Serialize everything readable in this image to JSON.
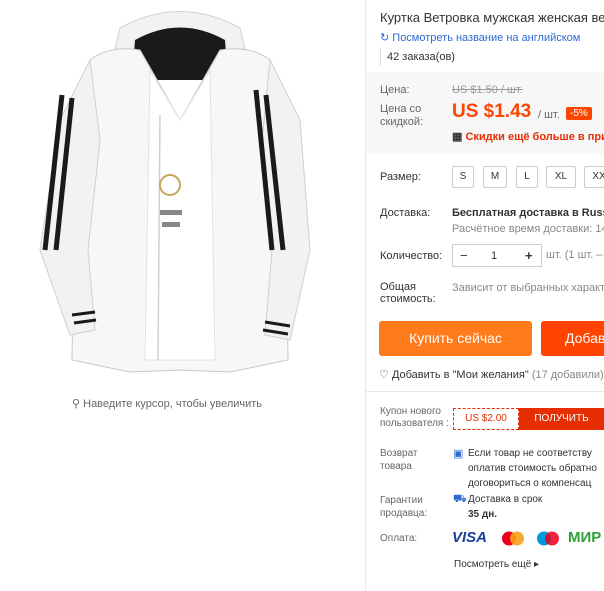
{
  "product": {
    "title": "Куртка Ветровка мужская женская ве",
    "translate_link": "Посмотреть название на английском",
    "orders": "42 заказа(ов)"
  },
  "gallery": {
    "zoom_hint": "Наведите курсор, чтобы увеличить"
  },
  "price": {
    "label": "Цена:",
    "old": "US $1.50 / шт.",
    "discount_label": "Цена со скидкой:",
    "new": "US $1.43",
    "per_unit": "/ шт.",
    "discount_badge": "-5%",
    "more_discounts": "Скидки ещё больше в прил"
  },
  "size": {
    "label": "Размер:",
    "options": [
      "S",
      "M",
      "L",
      "XL",
      "XX"
    ]
  },
  "delivery": {
    "label": "Доставка:",
    "value": "Бесплатная доставка в Russia",
    "time": "Расчётное время доставки: 14"
  },
  "quantity": {
    "label": "Количество:",
    "minus": "−",
    "value": "1",
    "plus": "+",
    "note": "шт. (1 шт. –"
  },
  "total": {
    "label": "Общая стоимость:",
    "value": "Зависит от выбранных характе"
  },
  "actions": {
    "buy_now": "Купить сейчас",
    "add_to_cart": "Добав",
    "wishlist": "Добавить в \"Мои желания\"",
    "wishlist_count": "(17 добавили)"
  },
  "coupon": {
    "label": "Купон нового пользователя :",
    "amount": "US $2.00",
    "button": "ПОЛУЧИТЬ"
  },
  "returns": {
    "label": "Возврат товара",
    "text_1": "Если товар не соответству",
    "text_2": "оплатив стоимость обратно",
    "text_3": "договориться о компенсац"
  },
  "guarantee": {
    "label": "Гарантии продавца:",
    "text": "Доставка в срок",
    "days": "35 дн."
  },
  "payment": {
    "label": "Оплата:",
    "visa": "VISA",
    "mir": "МИР",
    "see_more": "Посмотреть ещё"
  },
  "colors": {
    "accent_orange": "#ff7a1a",
    "accent_red": "#ff4400",
    "coupon_red": "#e62e04",
    "link_blue": "#2d6bd1"
  }
}
